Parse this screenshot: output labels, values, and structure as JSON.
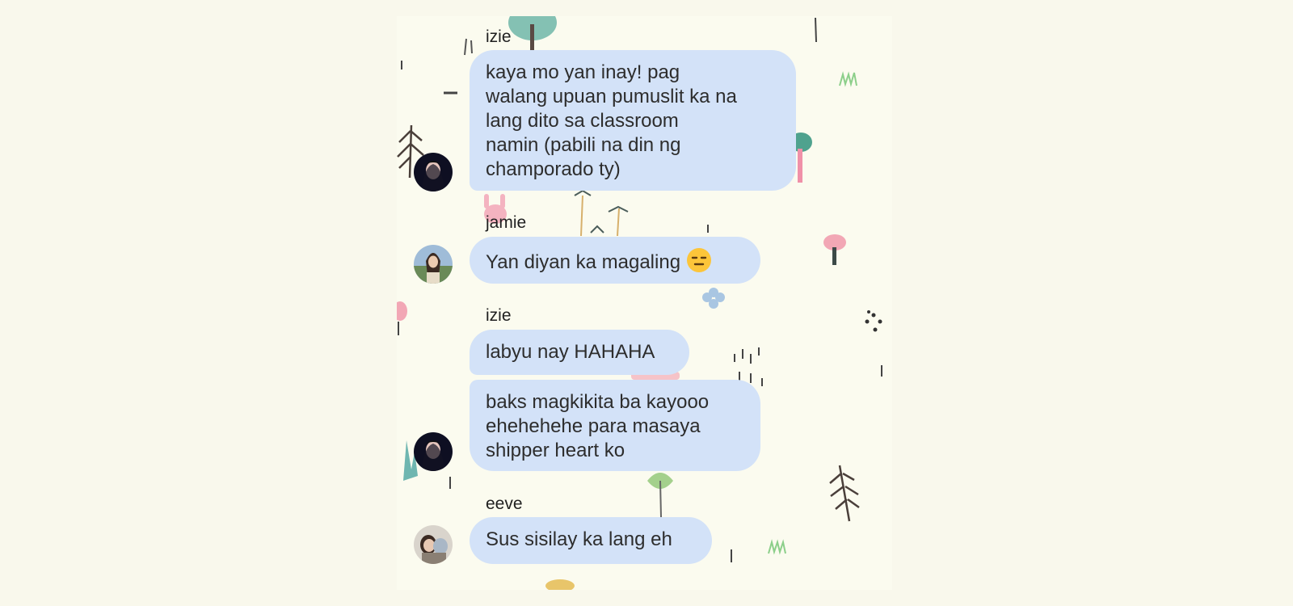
{
  "messages": [
    {
      "sender": "izie",
      "text": "kaya mo yan inay! pag\nwalang upuan pumuslit ka na\nlang dito sa classroom\nnamin (pabili na din ng\nchamporado ty)"
    },
    {
      "sender": "jamie",
      "text": "Yan diyan ka magaling",
      "emoji": "expressionless-face-icon"
    },
    {
      "sender": "izie",
      "text": "labyu nay HAHAHA"
    },
    {
      "sender": "",
      "text": "baks magkikita ba kayooo\nehehehehe para masaya\nshipper heart ko"
    },
    {
      "sender": "eeve",
      "text": "Sus sisilay ka lang eh"
    }
  ],
  "colors": {
    "bubble": "#d3e2f8",
    "background": "#fbfbef"
  }
}
